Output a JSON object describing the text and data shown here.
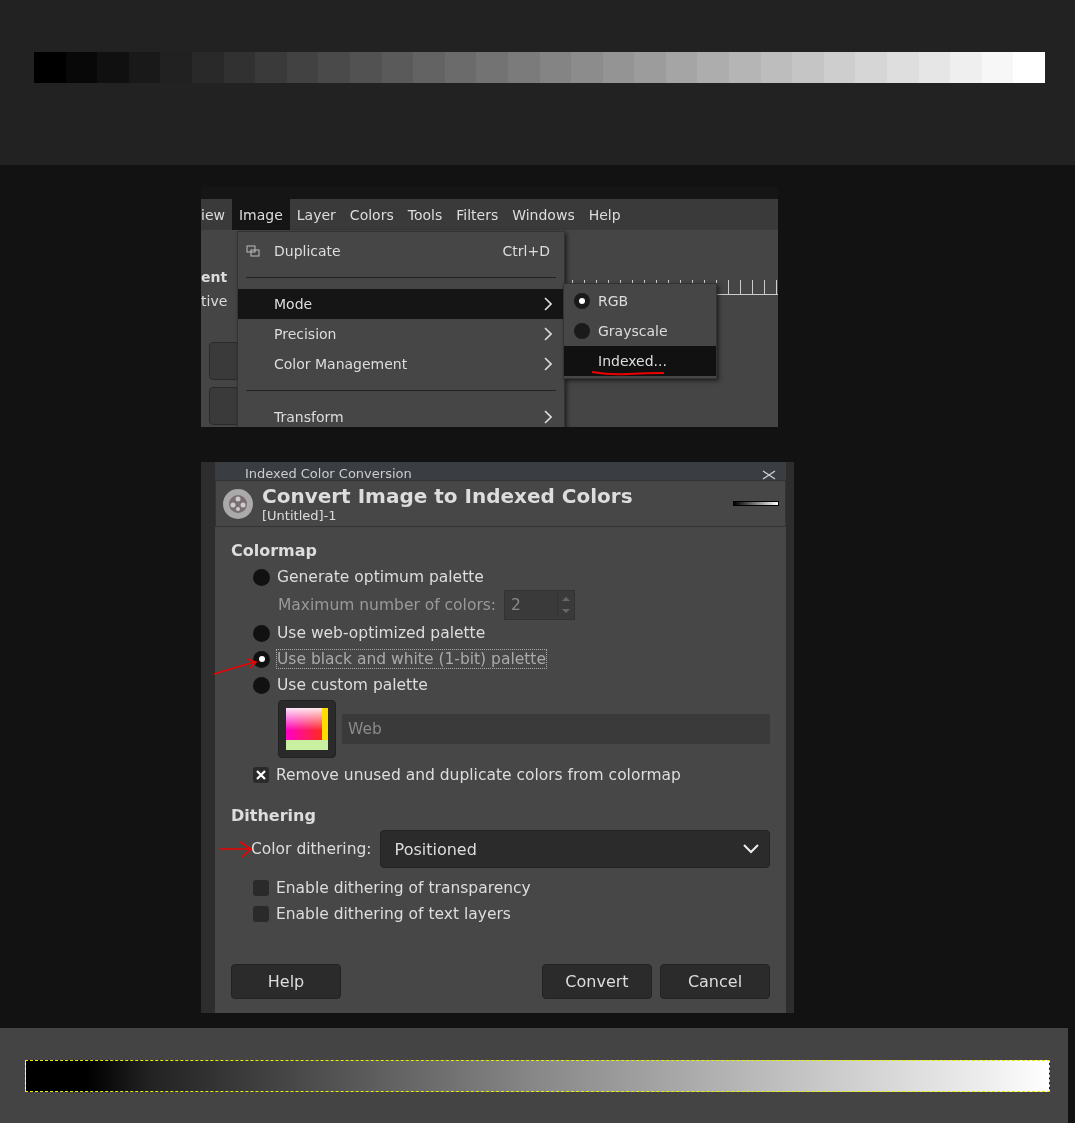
{
  "menu_screenshot": {
    "menubar": [
      {
        "label": "iew",
        "selected": false
      },
      {
        "label": "Image",
        "selected": true
      },
      {
        "label": "Layer",
        "selected": false
      },
      {
        "label": "Colors",
        "selected": false
      },
      {
        "label": "Tools",
        "selected": false
      },
      {
        "label": "Filters",
        "selected": false
      },
      {
        "label": "Windows",
        "selected": false
      },
      {
        "label": "Help",
        "selected": false
      }
    ],
    "side_fragments": [
      "ent",
      "tive"
    ],
    "menu": [
      {
        "kind": "item",
        "label": "Duplicate",
        "shortcut": "Ctrl+D",
        "icon": true,
        "selected": false
      },
      {
        "kind": "separator"
      },
      {
        "kind": "submenu",
        "label": "Mode",
        "selected": true
      },
      {
        "kind": "submenu",
        "label": "Precision",
        "selected": false
      },
      {
        "kind": "submenu",
        "label": "Color Management",
        "selected": false
      },
      {
        "kind": "separator"
      },
      {
        "kind": "submenu",
        "label": "Transform",
        "selected": false
      }
    ],
    "submenu": [
      {
        "kind": "radio",
        "label": "RGB",
        "checked": true,
        "selected": false,
        "annotated": false
      },
      {
        "kind": "radio",
        "label": "Grayscale",
        "checked": false,
        "selected": false,
        "annotated": false
      },
      {
        "kind": "plain",
        "label": "Indexed...",
        "selected": true,
        "annotated": true
      }
    ]
  },
  "dialog": {
    "window_title": "Indexed Color Conversion",
    "title": "Convert Image to Indexed Colors",
    "subtitle": "[Untitled]-1",
    "colormap_heading": "Colormap",
    "palette_options": [
      {
        "label": "Generate optimum palette",
        "selected": false,
        "annotated": false
      },
      {
        "label": "Use web-optimized palette",
        "selected": false,
        "annotated": false
      },
      {
        "label": "Use black and white (1-bit) palette",
        "selected": true,
        "annotated": true
      },
      {
        "label": "Use custom palette",
        "selected": false,
        "annotated": false
      }
    ],
    "max_colors": {
      "label": "Maximum number of colors:",
      "value": "2",
      "disabled": true
    },
    "custom_palette": {
      "value": "Web",
      "disabled": true
    },
    "remove_unused": {
      "label": "Remove unused and duplicate colors from colormap",
      "checked": true
    },
    "dithering_heading": "Dithering",
    "color_dithering": {
      "label": "Color dithering:",
      "value": "Positioned",
      "annotated": true
    },
    "dither_options": [
      {
        "label": "Enable dithering of transparency",
        "checked": false
      },
      {
        "label": "Enable dithering of text layers",
        "checked": false
      }
    ],
    "buttons": {
      "help": "Help",
      "convert": "Convert",
      "cancel": "Cancel"
    }
  }
}
